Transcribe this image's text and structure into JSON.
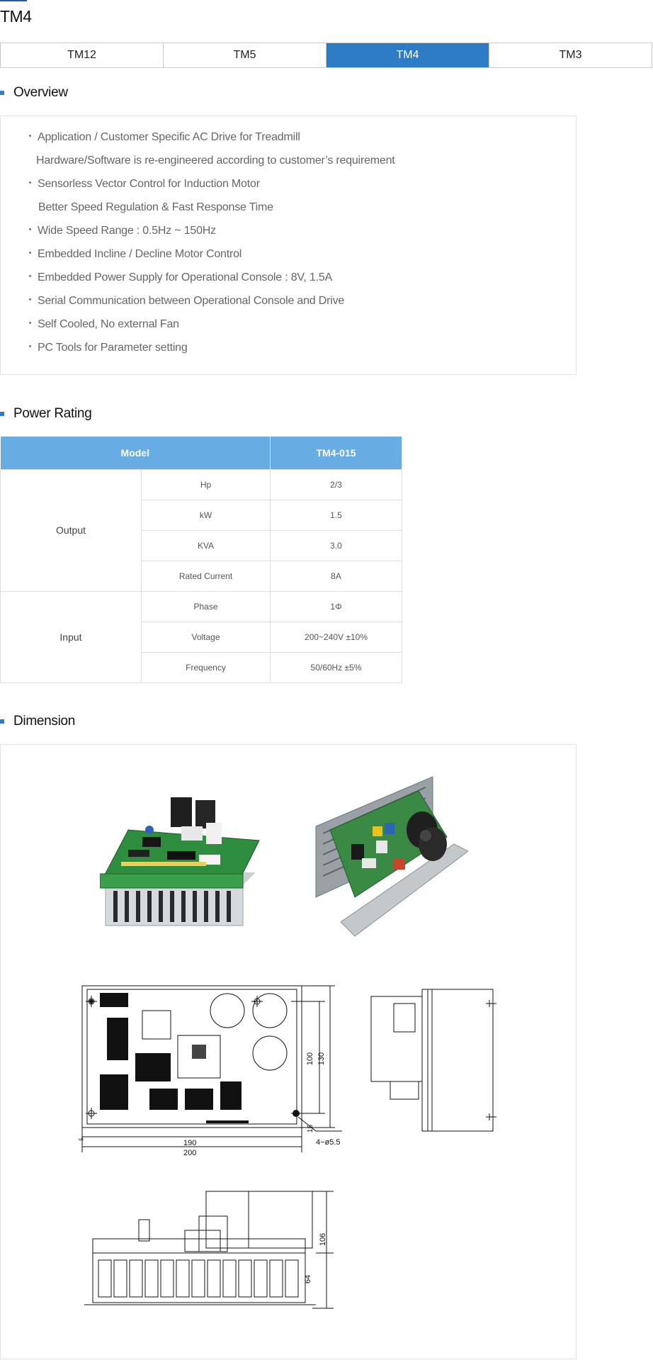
{
  "page": {
    "title": "TM4"
  },
  "tabs": [
    {
      "label": "TM12",
      "active": false
    },
    {
      "label": "TM5",
      "active": false
    },
    {
      "label": "TM4",
      "active": true
    },
    {
      "label": "TM3",
      "active": false
    }
  ],
  "overview": {
    "heading": "Overview",
    "lines": [
      {
        "text": "Application / Customer Specific AC Drive for Treadmill",
        "bullet": true
      },
      {
        "text": "Hardware/Software is re-engineered according to customer’s requirement",
        "bullet": false
      },
      {
        "text": "Sensorless Vector Control for Induction Motor",
        "bullet": true
      },
      {
        "text": "Better Speed Regulation & Fast Response Time",
        "bullet": false
      },
      {
        "text": "Wide Speed Range : 0.5Hz ~ 150Hz",
        "bullet": true
      },
      {
        "text": "Embedded Incline / Decline Motor Control",
        "bullet": true
      },
      {
        "text": "Embedded Power Supply for Operational Console : 8V, 1.5A",
        "bullet": true
      },
      {
        "text": "Serial Communication between Operational Console and Drive",
        "bullet": true
      },
      {
        "text": "Self Cooled, No external Fan",
        "bullet": true
      },
      {
        "text": "PC Tools for Parameter setting",
        "bullet": true
      }
    ]
  },
  "power_rating": {
    "heading": "Power Rating",
    "header": {
      "model_label": "Model",
      "model_value": "TM4-015"
    },
    "output": {
      "label": "Output",
      "rows": [
        {
          "name": "Hp",
          "value": "2/3"
        },
        {
          "name": "kW",
          "value": "1.5"
        },
        {
          "name": "KVA",
          "value": "3.0"
        },
        {
          "name": "Rated Current",
          "value": "8A"
        }
      ]
    },
    "input": {
      "label": "Input",
      "rows": [
        {
          "name": "Phase",
          "value": "1Φ"
        },
        {
          "name": "Voltage",
          "value": "200~240V ±10%"
        },
        {
          "name": "Frequency",
          "value": "50/60Hz ±5%"
        }
      ]
    }
  },
  "dimension": {
    "heading": "Dimension",
    "labels": {
      "w_inner": "190",
      "w_outer": "200",
      "h_inner": "100",
      "h_outer": "130",
      "h_offset": "15",
      "left_offset": "5",
      "hole": "4−ø5.5",
      "side_total": "106",
      "side_heatsink": "64"
    }
  }
}
